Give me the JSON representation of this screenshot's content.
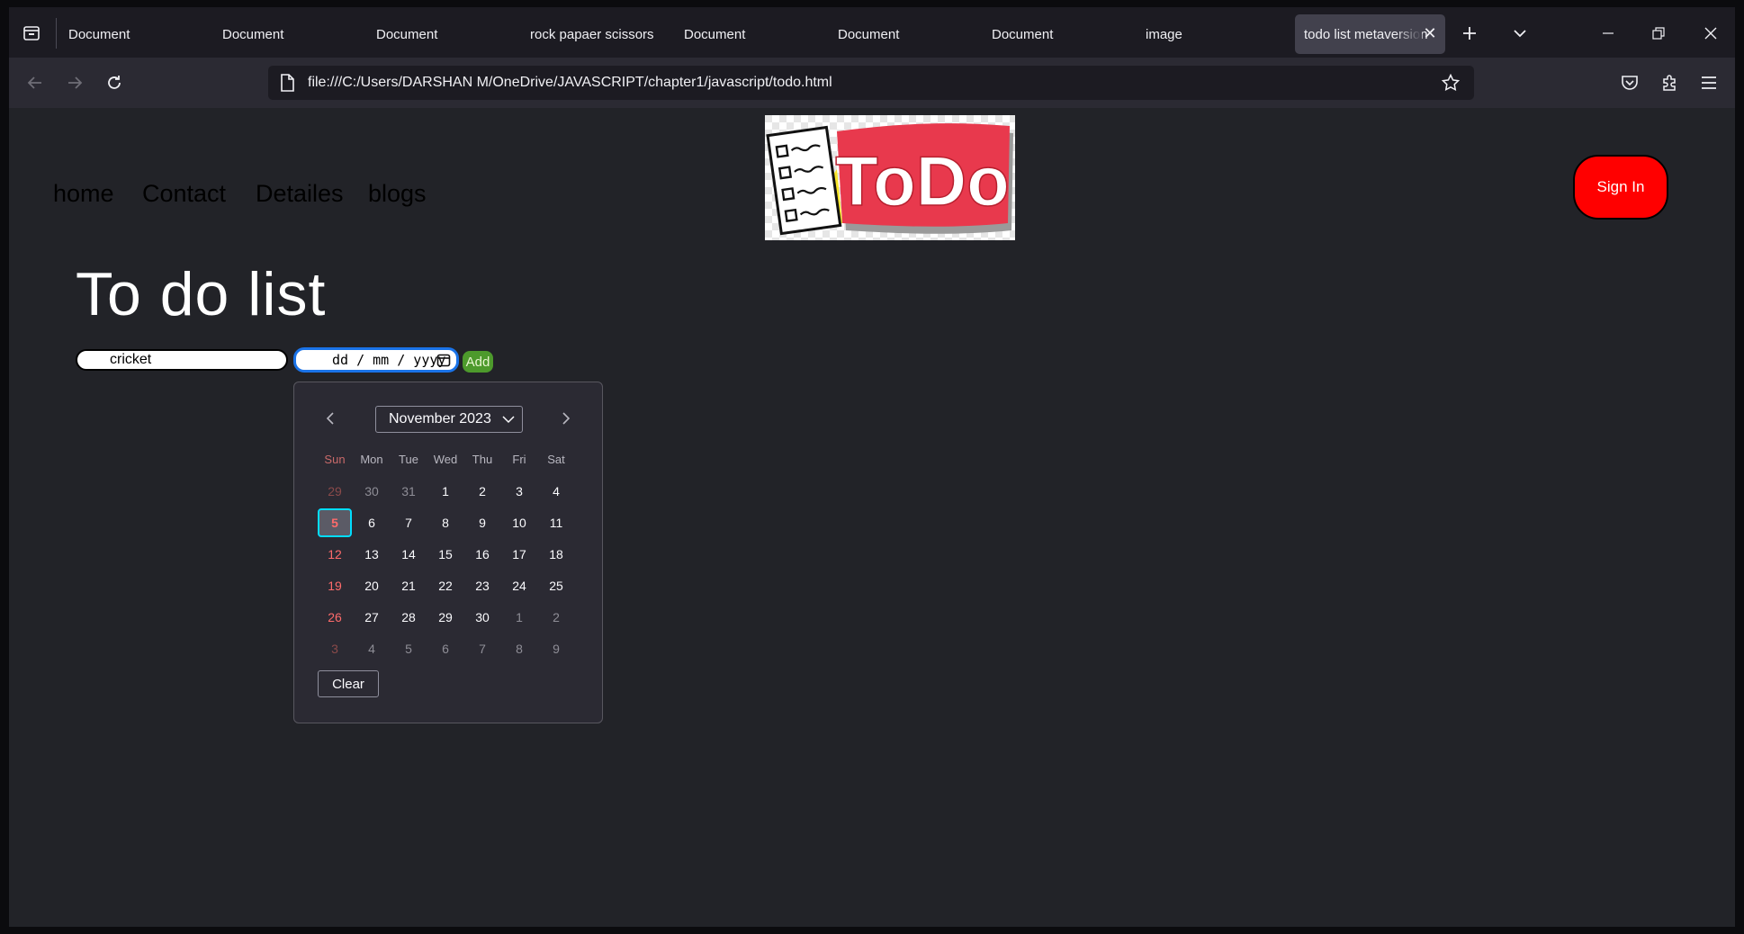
{
  "browser": {
    "tabs": [
      {
        "label": "Document"
      },
      {
        "label": "Document"
      },
      {
        "label": "Document"
      },
      {
        "label": "rock papaer scissors"
      },
      {
        "label": "Document"
      },
      {
        "label": "Document"
      },
      {
        "label": "Document"
      },
      {
        "label": "image"
      },
      {
        "label": "todo list metaversion"
      }
    ],
    "active_tab_index": 8,
    "url": "file:///C:/Users/DARSHAN M/OneDrive/JAVASCRIPT/chapter1/javascript/todo.html"
  },
  "page": {
    "nav": [
      "home",
      "Contact",
      "Detailes",
      "blogs"
    ],
    "logo_text": "ToDo",
    "signin_label": "Sign In",
    "title": "To do list",
    "task_value": "cricket",
    "date_placeholder": "dd / mm / yyyy",
    "add_label": "Add"
  },
  "datepicker": {
    "month_label": "November 2023",
    "weekdays": [
      "Sun",
      "Mon",
      "Tue",
      "Wed",
      "Thu",
      "Fri",
      "Sat"
    ],
    "weeks": [
      [
        "29",
        "30",
        "31",
        "1",
        "2",
        "3",
        "4"
      ],
      [
        "5",
        "6",
        "7",
        "8",
        "9",
        "10",
        "11"
      ],
      [
        "12",
        "13",
        "14",
        "15",
        "16",
        "17",
        "18"
      ],
      [
        "19",
        "20",
        "21",
        "22",
        "23",
        "24",
        "25"
      ],
      [
        "26",
        "27",
        "28",
        "29",
        "30",
        "1",
        "2"
      ],
      [
        "3",
        "4",
        "5",
        "6",
        "7",
        "8",
        "9"
      ]
    ],
    "today": "5",
    "clear_label": "Clear"
  },
  "colors": {
    "page_bg": "#222328",
    "signin_bg": "#ff0000",
    "add_bg": "#4d9a2c",
    "focus_ring": "#00ddff",
    "weekend_red": "#ff6b6b"
  }
}
